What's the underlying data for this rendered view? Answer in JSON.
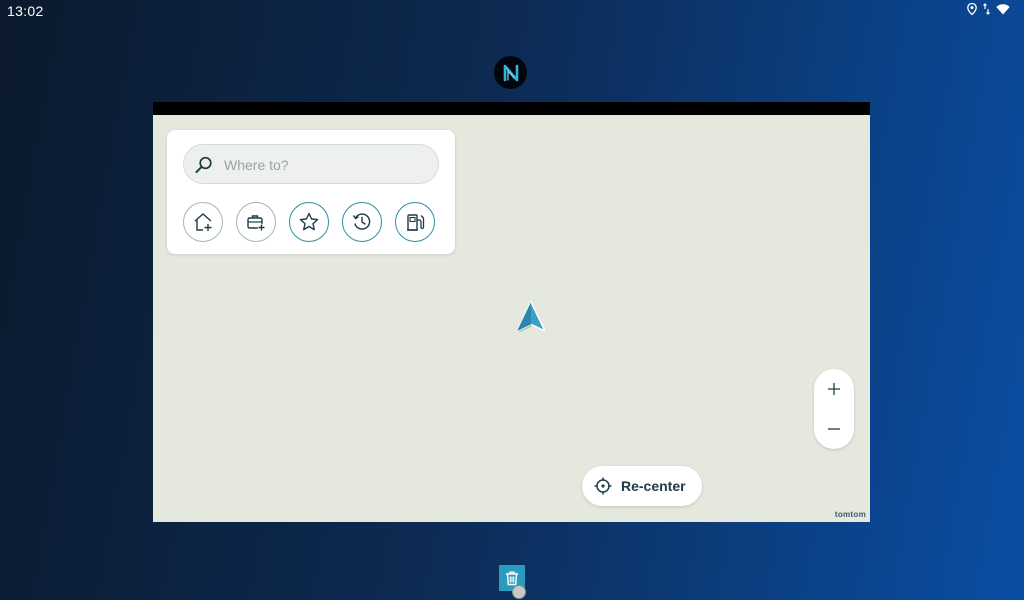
{
  "statusbar": {
    "time": "13:02",
    "icons": [
      "location-pin-icon",
      "data-arrows-icon",
      "wifi-icon"
    ]
  },
  "app_logo": {
    "icon": "navigation-app-logo-icon"
  },
  "search": {
    "placeholder": "Where to?",
    "value": ""
  },
  "shortcuts": [
    {
      "name": "add-home",
      "icon": "home-plus-icon"
    },
    {
      "name": "add-work",
      "icon": "briefcase-plus-icon"
    },
    {
      "name": "favorites",
      "icon": "star-icon"
    },
    {
      "name": "recent",
      "icon": "history-icon"
    },
    {
      "name": "fuel",
      "icon": "fuel-pump-icon"
    }
  ],
  "map": {
    "background": "#e4e8dd",
    "accent": "#2f8ea0",
    "position_color": "#3aa0c8",
    "brand": "tomtom"
  },
  "zoom": {
    "in_label": "+",
    "out_label": "—"
  },
  "recenter": {
    "label": "Re-center"
  },
  "trash": {
    "icon": "trash-icon",
    "color": "#2a9bbd"
  }
}
